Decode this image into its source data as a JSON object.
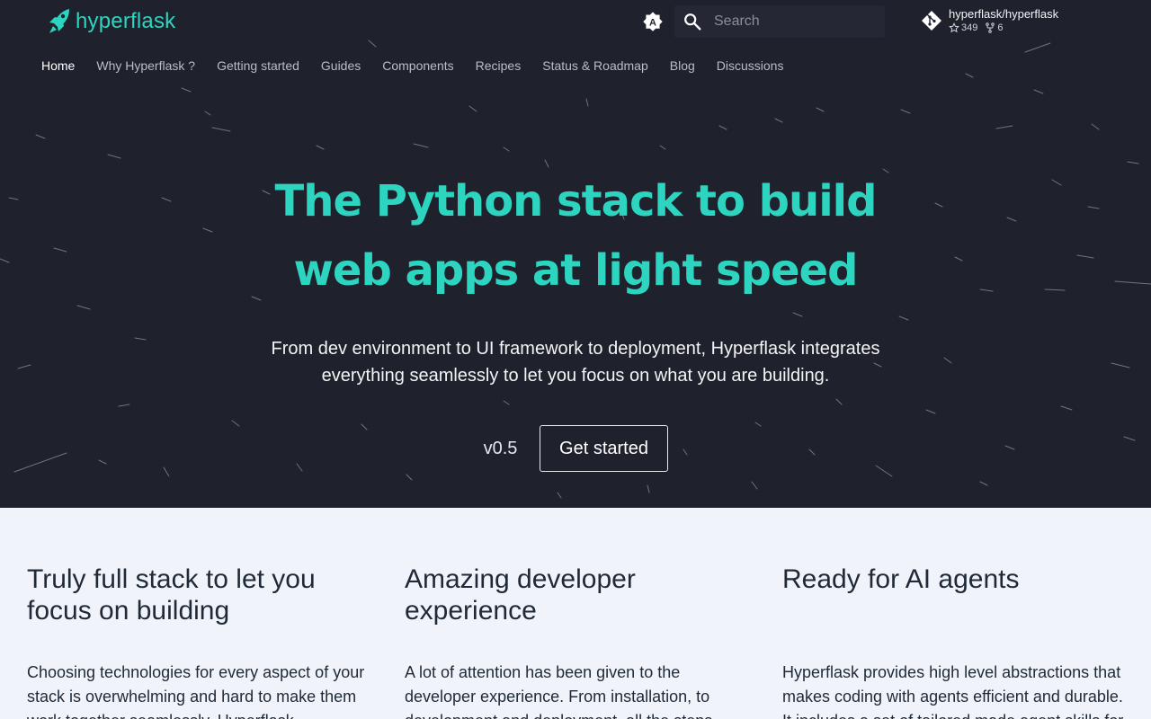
{
  "header": {
    "logo_text": "hyperflask",
    "theme_toggle_letter": "A",
    "search": {
      "placeholder": "Search",
      "value": ""
    },
    "repo": {
      "name": "hyperflask/hyperflask",
      "stars": "349",
      "forks": "6"
    }
  },
  "nav": {
    "items": [
      {
        "label": "Home",
        "active": true
      },
      {
        "label": "Why Hyperflask ?"
      },
      {
        "label": "Getting started"
      },
      {
        "label": "Guides"
      },
      {
        "label": "Components"
      },
      {
        "label": "Recipes"
      },
      {
        "label": "Status & Roadmap"
      },
      {
        "label": "Blog"
      },
      {
        "label": "Discussions"
      }
    ]
  },
  "hero": {
    "title_line1": "The Python stack to build",
    "title_line2": "web apps at light speed",
    "subtitle_line1": "From dev environment to UI framework to deployment, Hyperflask integrates",
    "subtitle_line2": "everything seamlessly to let you focus on what you are building.",
    "version": "v0.5",
    "cta_label": "Get started"
  },
  "features": [
    {
      "title": "Truly full stack to let you focus on building",
      "body": "Choosing technologies for every aspect of your stack is overwhelming and hard to make them work together seamlessly. Hyperflask"
    },
    {
      "title": "Amazing developer experience",
      "body": "A lot of attention has been given to the developer experience. From installation, to development and deployment, all the steps"
    },
    {
      "title": "Ready for AI agents",
      "body": "Hyperflask provides high level abstractions that makes coding with agents efficient and durable. It includes a set of tailored made agent skills for"
    }
  ],
  "colors": {
    "hero_bg": "#1f222c",
    "accent": "#2dd4bf",
    "features_bg": "#f0f4fa"
  },
  "icons": [
    "rocket-icon",
    "brightness-auto-icon",
    "search-icon",
    "git-icon",
    "star-icon",
    "fork-icon"
  ]
}
